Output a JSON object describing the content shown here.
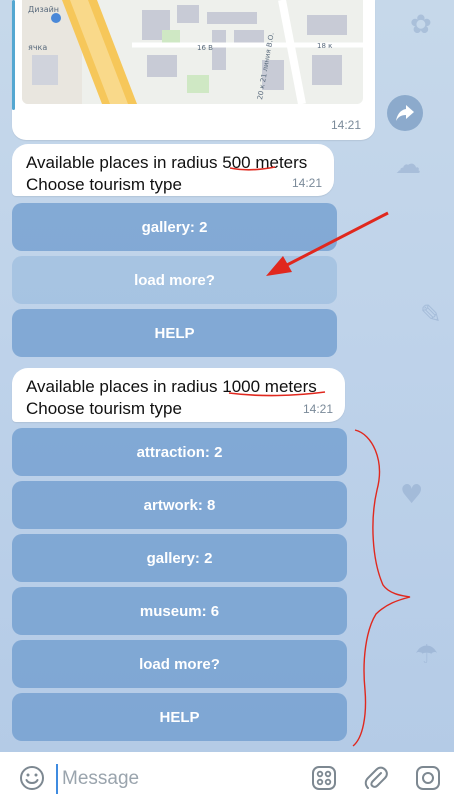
{
  "map_message": {
    "time": "14:21",
    "map_labels": [
      "Дизайн",
      "ячка",
      "16 В",
      "18 к",
      "20 к 21 линия В.О."
    ]
  },
  "messages": [
    {
      "line1_prefix": "Available places in radius ",
      "radius": "500",
      "line1_suffix": " meters",
      "line2": "Choose tourism type",
      "time": "14:21",
      "buttons": [
        "gallery: 2",
        "load more?",
        "HELP"
      ]
    },
    {
      "line1_prefix": "Available places in radius ",
      "radius": "1000",
      "line1_suffix": " meters",
      "line2": "Choose tourism type",
      "time": "14:21",
      "buttons": [
        "attraction: 2",
        "artwork: 8",
        "gallery: 2",
        "museum: 6",
        "load more?",
        "HELP"
      ]
    }
  ],
  "input_bar": {
    "placeholder": "Message"
  },
  "icons": {
    "forward": "share-arrow-icon",
    "emoji": "emoji-icon",
    "bot_menu": "bot-keyboard-icon",
    "attach": "paperclip-icon",
    "camera": "camera-icon"
  },
  "annotation_color": "#e0281e",
  "accent_color": "#3f8be0"
}
